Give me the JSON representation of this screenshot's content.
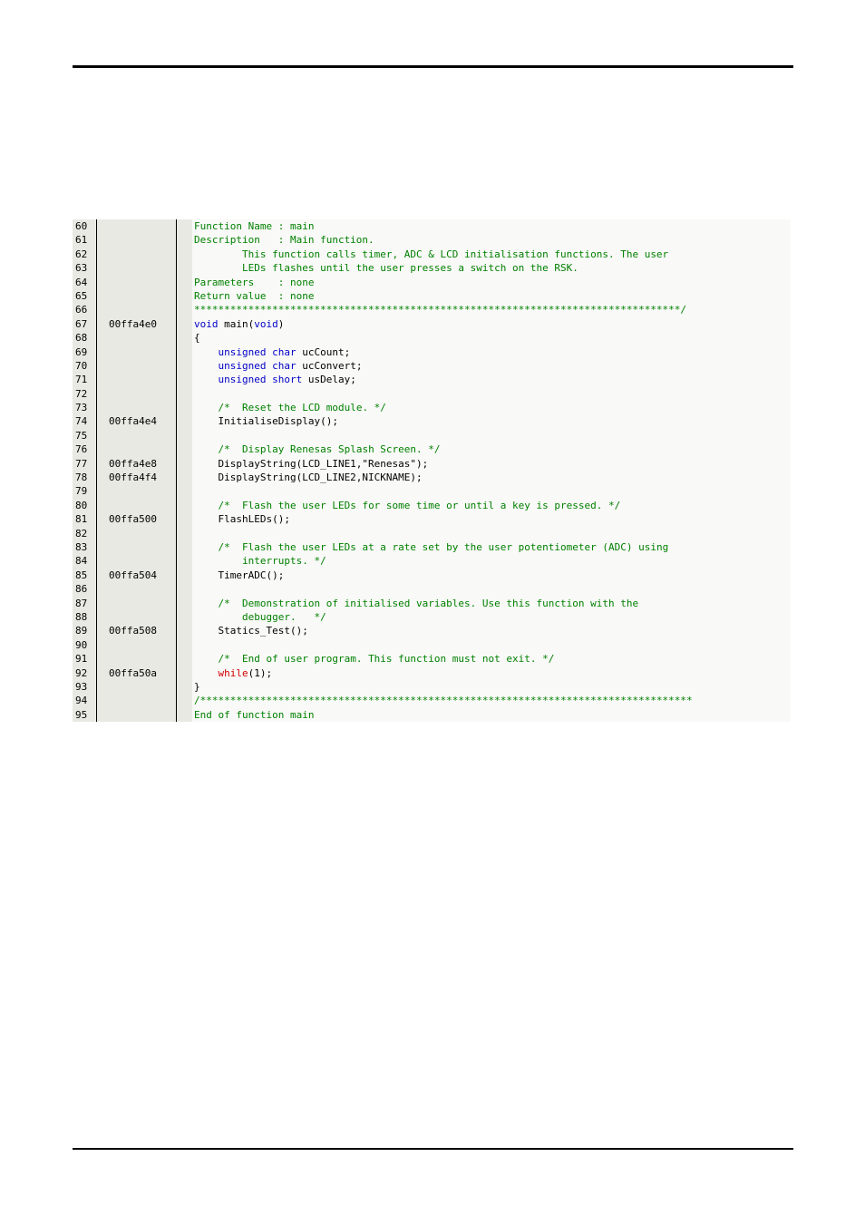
{
  "editor": {
    "rows": [
      {
        "n": "60",
        "addr": "",
        "code": [
          [
            "c",
            "Function Name : main"
          ]
        ]
      },
      {
        "n": "61",
        "addr": "",
        "code": [
          [
            "c",
            "Description   : Main function."
          ]
        ]
      },
      {
        "n": "62",
        "addr": "",
        "code": [
          [
            "c",
            "        This function calls timer, ADC & LCD initialisation functions. The user"
          ]
        ]
      },
      {
        "n": "63",
        "addr": "",
        "code": [
          [
            "c",
            "        LEDs flashes until the user presses a switch on the RSK."
          ]
        ]
      },
      {
        "n": "64",
        "addr": "",
        "code": [
          [
            "c",
            "Parameters    : none"
          ]
        ]
      },
      {
        "n": "65",
        "addr": "",
        "code": [
          [
            "c",
            "Return value  : none"
          ]
        ]
      },
      {
        "n": "66",
        "addr": "",
        "code": [
          [
            "c",
            "*********************************************************************************/"
          ]
        ]
      },
      {
        "n": "67",
        "addr": "00ffa4e0",
        "code": [
          [
            "k",
            "void"
          ],
          [
            "t",
            " main("
          ],
          [
            "k",
            "void"
          ],
          [
            "t",
            ")"
          ]
        ]
      },
      {
        "n": "68",
        "addr": "",
        "code": [
          [
            "t",
            "{"
          ]
        ]
      },
      {
        "n": "69",
        "addr": "",
        "code": [
          [
            "t",
            "    "
          ],
          [
            "k",
            "unsigned char"
          ],
          [
            "t",
            " ucCount;"
          ]
        ]
      },
      {
        "n": "70",
        "addr": "",
        "code": [
          [
            "t",
            "    "
          ],
          [
            "k",
            "unsigned char"
          ],
          [
            "t",
            " ucConvert;"
          ]
        ]
      },
      {
        "n": "71",
        "addr": "",
        "code": [
          [
            "t",
            "    "
          ],
          [
            "k",
            "unsigned short"
          ],
          [
            "t",
            " usDelay;"
          ]
        ]
      },
      {
        "n": "72",
        "addr": "",
        "code": []
      },
      {
        "n": "73",
        "addr": "",
        "code": [
          [
            "t",
            "    "
          ],
          [
            "c",
            "/*  Reset the LCD module. */"
          ]
        ]
      },
      {
        "n": "74",
        "addr": "00ffa4e4",
        "code": [
          [
            "t",
            "    InitialiseDisplay();"
          ]
        ]
      },
      {
        "n": "75",
        "addr": "",
        "code": []
      },
      {
        "n": "76",
        "addr": "",
        "code": [
          [
            "t",
            "    "
          ],
          [
            "c",
            "/*  Display Renesas Splash Screen. */"
          ]
        ]
      },
      {
        "n": "77",
        "addr": "00ffa4e8",
        "code": [
          [
            "t",
            "    DisplayString(LCD_LINE1,\"Renesas\");"
          ]
        ]
      },
      {
        "n": "78",
        "addr": "00ffa4f4",
        "code": [
          [
            "t",
            "    DisplayString(LCD_LINE2,NICKNAME);"
          ]
        ]
      },
      {
        "n": "79",
        "addr": "",
        "code": []
      },
      {
        "n": "80",
        "addr": "",
        "code": [
          [
            "t",
            "    "
          ],
          [
            "c",
            "/*  Flash the user LEDs for some time or until a key is pressed. */"
          ]
        ]
      },
      {
        "n": "81",
        "addr": "00ffa500",
        "code": [
          [
            "t",
            "    FlashLEDs();"
          ]
        ]
      },
      {
        "n": "82",
        "addr": "",
        "code": []
      },
      {
        "n": "83",
        "addr": "",
        "code": [
          [
            "t",
            "    "
          ],
          [
            "c",
            "/*  Flash the user LEDs at a rate set by the user potentiometer (ADC) using"
          ]
        ]
      },
      {
        "n": "84",
        "addr": "",
        "code": [
          [
            "c",
            "        interrupts. */"
          ]
        ]
      },
      {
        "n": "85",
        "addr": "00ffa504",
        "code": [
          [
            "t",
            "    TimerADC();"
          ]
        ]
      },
      {
        "n": "86",
        "addr": "",
        "code": []
      },
      {
        "n": "87",
        "addr": "",
        "code": [
          [
            "t",
            "    "
          ],
          [
            "c",
            "/*  Demonstration of initialised variables. Use this function with the"
          ]
        ]
      },
      {
        "n": "88",
        "addr": "",
        "code": [
          [
            "c",
            "        debugger.   */"
          ]
        ]
      },
      {
        "n": "89",
        "addr": "00ffa508",
        "code": [
          [
            "t",
            "    Statics_Test();"
          ]
        ]
      },
      {
        "n": "90",
        "addr": "",
        "code": []
      },
      {
        "n": "91",
        "addr": "",
        "code": [
          [
            "t",
            "    "
          ],
          [
            "c",
            "/*  End of user program. This function must not exit. */"
          ]
        ]
      },
      {
        "n": "92",
        "addr": "00ffa50a",
        "code": [
          [
            "t",
            "    "
          ],
          [
            "w",
            "while"
          ],
          [
            "t",
            "(1);"
          ]
        ]
      },
      {
        "n": "93",
        "addr": "",
        "code": [
          [
            "t",
            "}"
          ]
        ]
      },
      {
        "n": "94",
        "addr": "",
        "code": [
          [
            "c",
            "/**********************************************************************************"
          ]
        ]
      },
      {
        "n": "95",
        "addr": "",
        "code": [
          [
            "c",
            "End of function main"
          ]
        ]
      }
    ]
  }
}
